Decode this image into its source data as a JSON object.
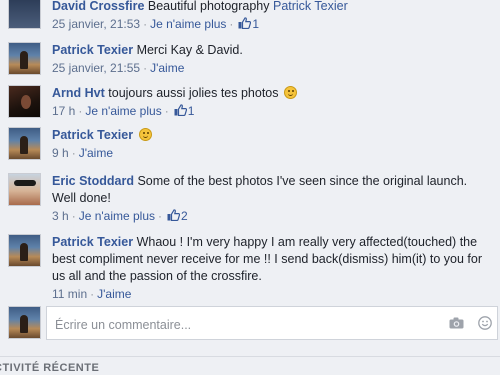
{
  "comments": [
    {
      "author": "David Crossfire",
      "text": "Beautiful photography ",
      "mention": "Patrick Texier",
      "time": "25 janvier, 21:53",
      "action": "Je n'aime plus",
      "likes": "1"
    },
    {
      "author": "Patrick Texier",
      "text": "Merci Kay & David.",
      "time": "25 janvier, 21:55",
      "action": "J'aime"
    },
    {
      "author": "Arnd Hvt",
      "text": "toujours aussi jolies tes photos",
      "time": "17 h",
      "action": "Je n'aime plus",
      "likes": "1"
    },
    {
      "author": "Patrick Texier",
      "text": "",
      "time": "9 h",
      "action": "J'aime"
    },
    {
      "author": "Eric Stoddard",
      "text": "Some of the best photos I've seen since the original launch. Well done!",
      "time": "3 h",
      "action": "Je n'aime plus",
      "likes": "2"
    },
    {
      "author": "Patrick Texier",
      "text": "Whaou ! I'm very happy I am really very affected(touched) the best compliment never receive for me !! I send back(dismiss) him(it) to you for us all and the passion of the crossfire.",
      "time": "11 min",
      "action": "J'aime"
    }
  ],
  "composer": {
    "placeholder": "Écrire un commentaire..."
  },
  "section": {
    "title": "CTIVITÉ RÉCENTE"
  },
  "colors": {
    "link": "#365899",
    "meta": "#5d6f8e",
    "background": "#eef0f4"
  }
}
